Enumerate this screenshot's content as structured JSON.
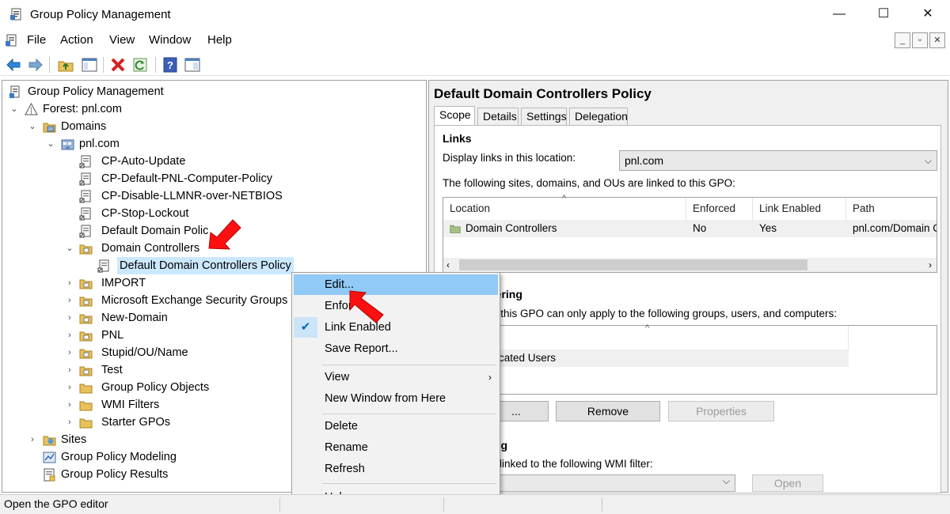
{
  "window": {
    "title": "Group Policy Management",
    "controls": [
      "—",
      "☐",
      "✕"
    ]
  },
  "menubar": {
    "items": [
      "File",
      "Action",
      "View",
      "Window",
      "Help"
    ],
    "mdi_controls": [
      "_",
      "▫",
      "✕"
    ]
  },
  "toolbar": {
    "buttons": [
      "back-icon",
      "forward-icon",
      "up-folder-icon",
      "show-hide-tree-icon",
      "delete-icon",
      "refresh-icon",
      "help-icon",
      "properties-icon"
    ]
  },
  "tree": {
    "nodes": [
      {
        "label": "Group Policy Management",
        "icon": "gpm-icon"
      },
      {
        "label": "Forest: pnl.com",
        "icon": "forest-icon"
      },
      {
        "label": "Domains",
        "icon": "domains-icon"
      },
      {
        "label": "pnl.com",
        "icon": "domain-icon"
      },
      {
        "label": "CP-Auto-Update",
        "icon": "gpo-link-icon"
      },
      {
        "label": "CP-Default-PNL-Computer-Policy",
        "icon": "gpo-link-icon"
      },
      {
        "label": "CP-Disable-LLMNR-over-NETBIOS",
        "icon": "gpo-link-icon"
      },
      {
        "label": "CP-Stop-Lockout",
        "icon": "gpo-link-icon"
      },
      {
        "label": "Default Domain Polic",
        "icon": "gpo-link-icon"
      },
      {
        "label": "Domain Controllers",
        "icon": "ou-icon"
      },
      {
        "label": "Default Domain Controllers Policy",
        "icon": "gpo-link-icon"
      },
      {
        "label": "IMPORT",
        "icon": "ou-icon"
      },
      {
        "label": "Microsoft Exchange Security Groups",
        "icon": "ou-icon"
      },
      {
        "label": "New-Domain",
        "icon": "ou-icon"
      },
      {
        "label": "PNL",
        "icon": "ou-icon"
      },
      {
        "label": "Stupid/OU/Name",
        "icon": "ou-icon"
      },
      {
        "label": "Test",
        "icon": "ou-icon"
      },
      {
        "label": "Group Policy Objects",
        "icon": "folder-icon"
      },
      {
        "label": "WMI Filters",
        "icon": "folder-icon"
      },
      {
        "label": "Starter GPOs",
        "icon": "folder-icon"
      },
      {
        "label": "Sites",
        "icon": "sites-icon"
      },
      {
        "label": "Group Policy Modeling",
        "icon": "modeling-icon"
      },
      {
        "label": "Group Policy Results",
        "icon": "results-icon"
      }
    ]
  },
  "details": {
    "title": "Default Domain Controllers Policy",
    "tabs": [
      "Scope",
      "Details",
      "Settings",
      "Delegation"
    ],
    "links_heading": "Links",
    "display_links_label": "Display links in this location:",
    "display_links_value": "pnl.com",
    "linked_text": "The following sites, domains, and OUs are linked to this GPO:",
    "links_columns": [
      "Location",
      "Enforced",
      "Link Enabled",
      "Path"
    ],
    "links_rows": [
      {
        "location": "Domain Controllers",
        "enforced": "No",
        "link_enabled": "Yes",
        "path": "pnl.com/Domain C"
      }
    ],
    "filtering_heading_partial": "tering",
    "filtering_text_partial": "n this GPO can only apply to the following groups, users, and computers:",
    "filtering_row_partial": "cated Users",
    "add_button_partial": "...",
    "remove_button": "Remove",
    "properties_button": "Properties",
    "wmi_heading_partial": "ng",
    "wmi_text_partial": "linked to the following WMI filter:",
    "open_button_partial": "Open"
  },
  "context_menu": {
    "items": [
      {
        "label": "Edit..."
      },
      {
        "label": "Enfor"
      },
      {
        "label": "Link Enabled"
      },
      {
        "label": "Save Report..."
      },
      {
        "label": "View"
      },
      {
        "label": "New Window from Here"
      },
      {
        "label": "Delete"
      },
      {
        "label": "Rename"
      },
      {
        "label": "Refresh"
      },
      {
        "label": "Help"
      }
    ]
  },
  "statusbar": {
    "text": "Open the GPO editor"
  },
  "colors": {
    "selection": "#cce8ff",
    "menu_highlight": "#91c9f7",
    "arrow_red": "#ff0000"
  }
}
